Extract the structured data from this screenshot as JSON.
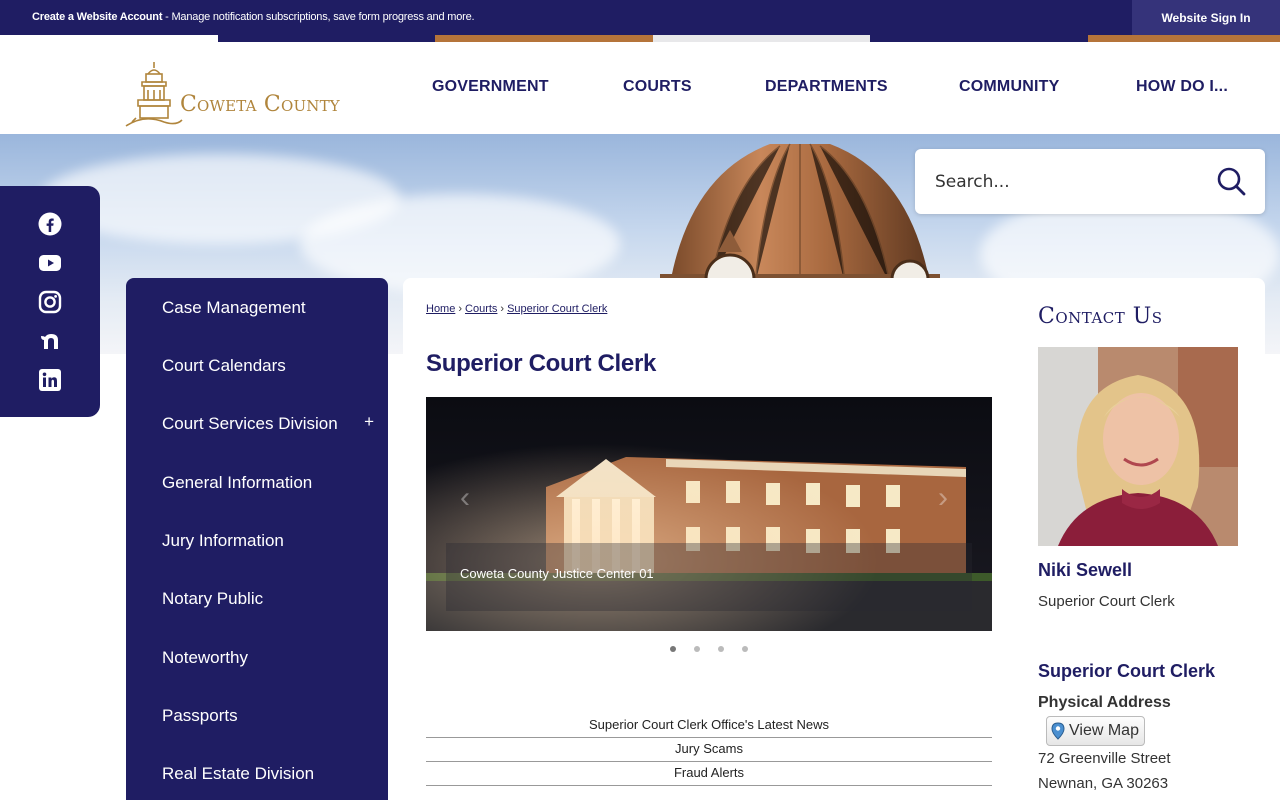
{
  "topbar": {
    "create_bold": "Create a Website Account",
    "create_rest": " - Manage notification subscriptions, save form progress and more.",
    "signin": "Website Sign In"
  },
  "colors": {
    "navy": "#1f1d63",
    "gold": "#b0853c",
    "strip": [
      "#ffffff",
      "#1f1d63",
      "#b5743a",
      "#e8e8ea",
      "#1f1d63",
      "#b5743a"
    ]
  },
  "header": {
    "logo_text": "Coweta County",
    "nav": [
      "GOVERNMENT",
      "COURTS",
      "DEPARTMENTS",
      "COMMUNITY",
      "HOW DO I..."
    ]
  },
  "search": {
    "placeholder": "Search...",
    "icon": "search-icon"
  },
  "social": [
    "facebook-icon",
    "youtube-icon",
    "instagram-icon",
    "nextdoor-icon",
    "linkedin-icon"
  ],
  "leftnav": {
    "items": [
      {
        "label": "Case Management",
        "expandable": false
      },
      {
        "label": "Court Calendars",
        "expandable": false
      },
      {
        "label": "Court Services Division",
        "expandable": true,
        "toggle": "+"
      },
      {
        "label": "General Information",
        "expandable": false
      },
      {
        "label": "Jury Information",
        "expandable": false
      },
      {
        "label": "Notary Public",
        "expandable": false
      },
      {
        "label": "Noteworthy",
        "expandable": false
      },
      {
        "label": "Passports",
        "expandable": false
      },
      {
        "label": "Real Estate Division",
        "expandable": false
      }
    ]
  },
  "breadcrumb": {
    "home": "Home",
    "sep1": "›",
    "courts": "Courts",
    "sep2": "›",
    "current": "Superior Court Clerk"
  },
  "page": {
    "title": "Superior Court Clerk"
  },
  "slider": {
    "caption": "Coweta County Justice Center 01",
    "prev": "‹",
    "next": "›",
    "slide_count": 4,
    "active_index": 0
  },
  "news": [
    "Superior Court Clerk Office's Latest News",
    "Jury Scams",
    "Fraud Alerts"
  ],
  "contact": {
    "heading": "Contact Us",
    "person_name": "Niki Sewell",
    "person_title": "Superior Court Clerk",
    "dept_name": "Superior Court Clerk",
    "address_label": "Physical Address",
    "map_button": "View Map",
    "address_line1": "72 Greenville Street",
    "address_line2": "Newnan, GA 30263"
  }
}
